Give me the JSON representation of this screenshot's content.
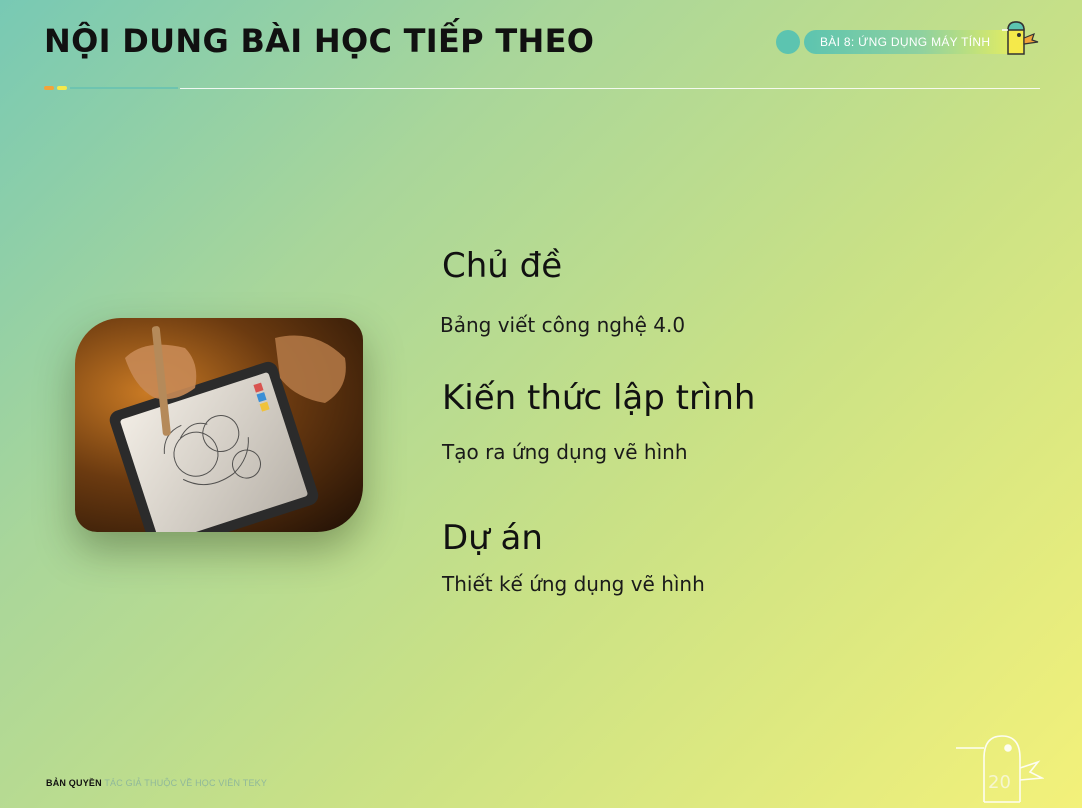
{
  "header": {
    "title": "NỘI DUNG BÀI HỌC TIẾP THEO",
    "lesson_badge": "BÀI 8: ỨNG DỤNG MÁY TÍNH"
  },
  "sections": [
    {
      "heading": "Chủ đề",
      "text": "Bảng viết công nghệ 4.0"
    },
    {
      "heading": "Kiến thức lập trình",
      "text": "Tạo ra ứng dụng vẽ hình"
    },
    {
      "heading": "Dự án",
      "text": "Thiết kế ứng dụng vẽ hình"
    }
  ],
  "image": {
    "icon": "tablet-drawing-photo"
  },
  "footer": {
    "copyright_label": "BẢN QUYỀN",
    "copyright_text": "TÁC GIẢ THUỘC VỀ HỌC VIÊN TEKY"
  },
  "page_number": "20",
  "colors": {
    "accent_teal": "#5cc4b0",
    "accent_yellow": "#f5e94a",
    "accent_orange": "#f2a33a"
  }
}
